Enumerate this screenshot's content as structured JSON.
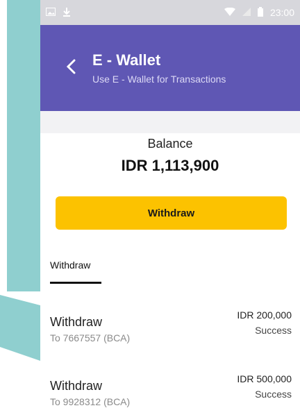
{
  "statusbar": {
    "time": "23:00",
    "icons": [
      "image-icon",
      "download-icon",
      "wifi-icon",
      "signal-icon",
      "battery-icon"
    ]
  },
  "header": {
    "title": "E - Wallet",
    "subtitle": "Use E - Wallet for Transactions"
  },
  "balance": {
    "label": "Balance",
    "amount": "IDR 1,113,900"
  },
  "actions": {
    "withdraw_label": "Withdraw"
  },
  "tabs": {
    "active_label": "Withdraw"
  },
  "transactions": [
    {
      "name": "Withdraw",
      "to": "To 7667557 (BCA)",
      "amount": "IDR 200,000",
      "status": "Success"
    },
    {
      "name": "Withdraw",
      "to": "To 9928312 (BCA)",
      "amount": "IDR 500,000",
      "status": "Success"
    }
  ],
  "colors": {
    "header": "#5f57b4",
    "button": "#fcc200",
    "decor": "#86c8c7"
  }
}
